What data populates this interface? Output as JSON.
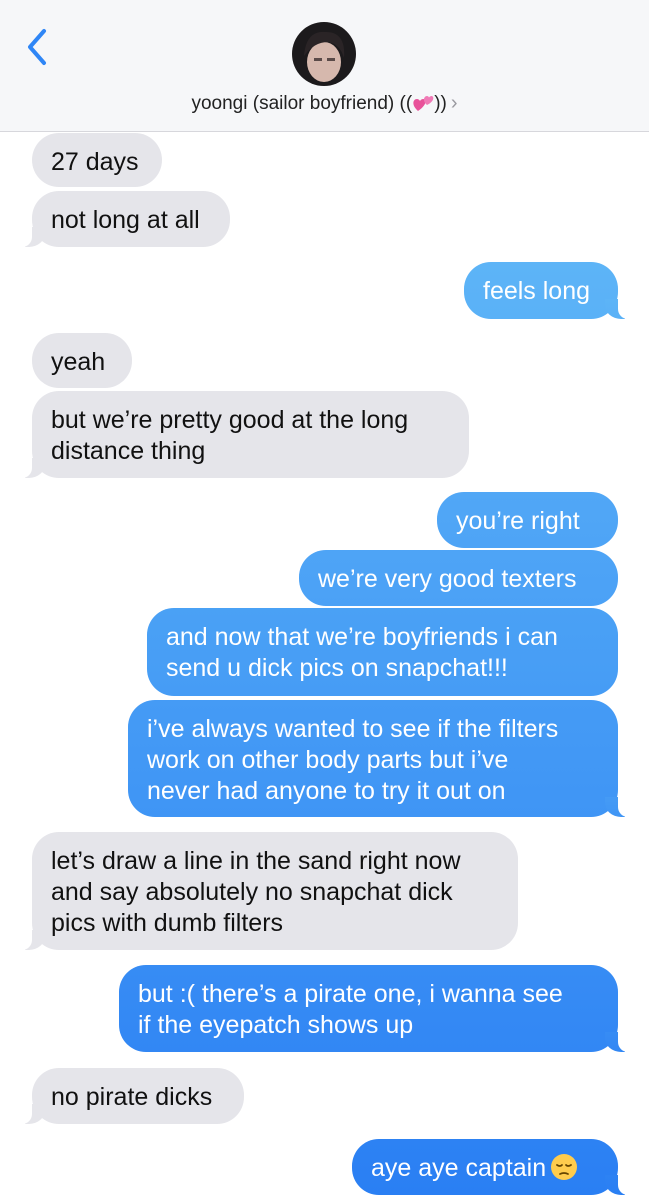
{
  "header": {
    "contact_name": "yoongi (sailor boyfriend) ((",
    "contact_suffix": "))",
    "chevron": "›",
    "back_icon": "chevron-left-icon",
    "heart_icon": "two-hearts-emoji"
  },
  "colors": {
    "incoming": "#e5e5ea",
    "outgoing_light": "#5eb5f7",
    "outgoing_dark": "#2a7ff3",
    "accent": "#2f86f6"
  },
  "messages": [
    {
      "from": "them",
      "lines": [
        "27 days"
      ]
    },
    {
      "from": "them",
      "lines": [
        "not long at all"
      ]
    },
    {
      "from": "me",
      "lines": [
        "feels long"
      ]
    },
    {
      "from": "them",
      "lines": [
        "yeah"
      ]
    },
    {
      "from": "them",
      "lines": [
        "but we’re pretty good at the long",
        "distance thing"
      ]
    },
    {
      "from": "me",
      "lines": [
        "you’re right"
      ]
    },
    {
      "from": "me",
      "lines": [
        "we’re very good texters"
      ]
    },
    {
      "from": "me",
      "lines": [
        "and now that we’re boyfriends i can",
        "send u dick pics on snapchat!!!"
      ]
    },
    {
      "from": "me",
      "lines": [
        "i’ve always wanted to see if the filters",
        "work on other body parts but i’ve",
        "never had anyone to try it out on"
      ]
    },
    {
      "from": "them",
      "lines": [
        "let’s draw a line in the sand right now",
        "and say absolutely no snapchat dick",
        "pics with dumb filters"
      ]
    },
    {
      "from": "me",
      "lines": [
        "but :( there’s a pirate one, i wanna see",
        "if the eyepatch shows up"
      ]
    },
    {
      "from": "them",
      "lines": [
        "no pirate dicks"
      ]
    },
    {
      "from": "me",
      "lines": [
        "aye aye captain"
      ],
      "emoji": "pensive-face-emoji"
    }
  ]
}
